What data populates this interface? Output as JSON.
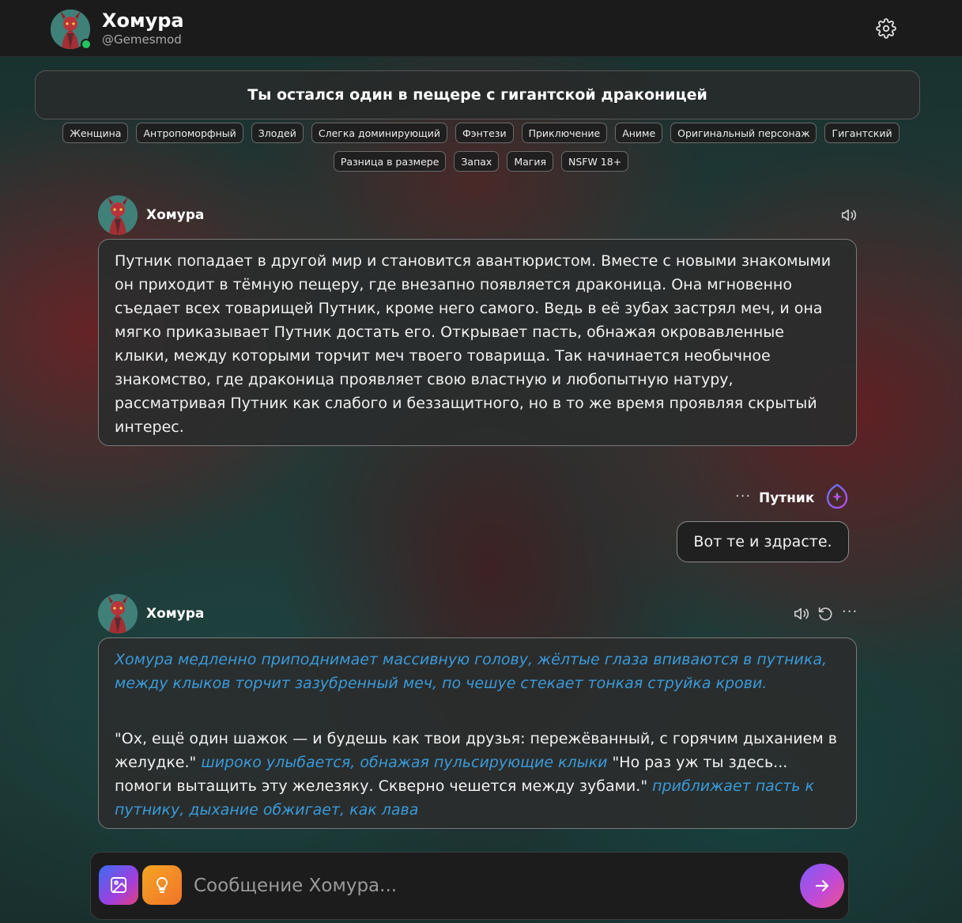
{
  "header": {
    "name": "Хомура",
    "handle": "@Gemesmod"
  },
  "scenario": {
    "title": "Ты остался один в пещере с гигантской драконицей"
  },
  "tags": {
    "row1": [
      "Женщина",
      "Антропоморфный",
      "Злодей",
      "Слегка доминирующий",
      "Фэнтези",
      "Приключение",
      "Аниме",
      "Оригинальный персонаж",
      "Гигантский"
    ],
    "row2": [
      "Разница в размере",
      "Запах",
      "Магия",
      "NSFW 18+"
    ]
  },
  "messages": {
    "first": {
      "author": "Хомура",
      "text": "Путник попадает в другой мир и становится авантюристом. Вместе с новыми знакомыми он приходит в тёмную пещеру, где внезапно появляется драконица. Она мгновенно съедает всех товарищей Путник, кроме него самого. Ведь в её зубах застрял меч, и она мягко приказывает Путник достать его. Открывает пасть, обнажая окровавленные клыки, между которыми торчит меч твоего товарища. Так начинается необычное знакомство, где драконица проявляет свою властную и любопытную натуру, рассматривая Путник как слабого и беззащитного, но в то же время проявляя скрытый интерес."
    },
    "user": {
      "author": "Путник",
      "more": "···",
      "text": "Вот те и здрасте."
    },
    "second": {
      "author": "Хомура",
      "more": "···",
      "action1": "Хомура медленно приподнимает массивную голову, жёлтые глаза впиваются в путника, между клыков торчит зазубренный меч, по чешуе стекает тонкая струйка крови.",
      "speech1": "\"Ох, ещё один шажок — и будешь как твои друзья: пережёванный, с горячим дыханием в желудке.\" ",
      "action2": "широко улыбается, обнажая пульсирующие клыки",
      "speech2": " \"Но раз уж ты здесь... помоги вытащить эту железяку. Скверно чешется между зубами.\" ",
      "action3": "приближает пасть к путнику, дыхание обжигает, как лава"
    }
  },
  "input": {
    "placeholder": "Сообщение Хомура..."
  },
  "icons": {
    "settings": "gear-icon",
    "speaker": "speaker-icon",
    "regenerate": "refresh-icon",
    "more": "more-dots-icon",
    "user_avatar": "compass-logo-icon",
    "image": "image-icon",
    "idea": "lightbulb-icon",
    "send": "arrow-right-icon"
  },
  "colors": {
    "action_text": "#3a9ad9",
    "online": "#22c55e",
    "idea_button": "#f5a623",
    "send_button": "#c04ad8"
  }
}
